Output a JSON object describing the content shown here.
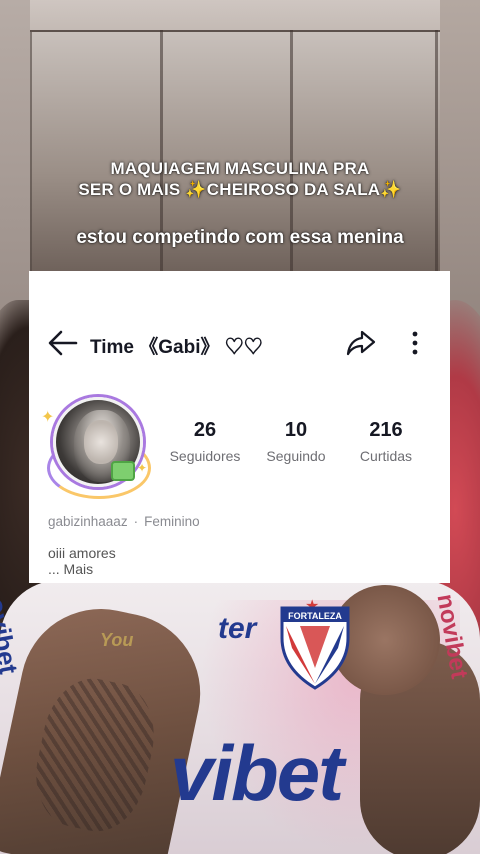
{
  "caption": {
    "title_line1": "MAQUIAGEM MASCULINA PRA",
    "title_line2": "SER O MAIS ✨CHEIROSO DA SALA✨",
    "subtitle": "estou competindo com essa menina"
  },
  "profile": {
    "name": "Time 《Gabi》 ♡♡",
    "username": "gabizinhaaaz",
    "gender": "Feminino",
    "separator": "·",
    "bio": "oiii amores",
    "bio_more": "...  Mais",
    "stats": [
      {
        "value": "26",
        "label": "Seguidores"
      },
      {
        "value": "10",
        "label": "Seguindo"
      },
      {
        "value": "216",
        "label": "Curtidas"
      }
    ]
  },
  "background": {
    "shirt_sponsor_main": "vibet",
    "shirt_sponsor_top": "ter",
    "shirt_sponsor_side_left": "novibet",
    "shirt_sponsor_side_right": "novibet",
    "shirt_small_logo": "You",
    "crest_text": "FORTALEZA"
  },
  "icons": {
    "back": "arrow-left-icon",
    "share": "share-arrow-icon",
    "more": "more-vertical-icon"
  },
  "colors": {
    "card_bg": "#ffffff",
    "text_primary": "#161823",
    "text_secondary": "#8a8b91",
    "shirt_blue": "#233a8f",
    "crest_red": "#d23a3a"
  }
}
